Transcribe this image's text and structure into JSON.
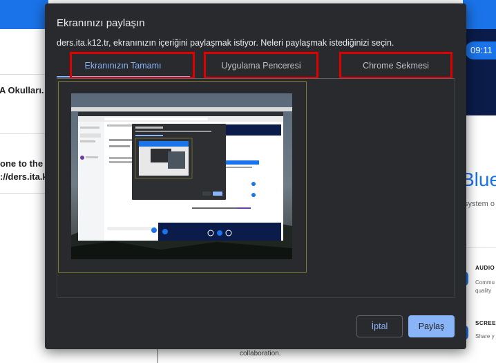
{
  "background": {
    "time": "09:11",
    "left_text_1": "A Okulları.",
    "left_text_2": "one to the",
    "left_text_3": "://ders.ita.k",
    "bottom_text": "collaboration.",
    "right_title": "Blue",
    "right_subtitle": "system o",
    "feature_1_label": "AUDIO",
    "feature_1_text_a": "Commu",
    "feature_1_text_b": "quality",
    "feature_2_label": "SCREE",
    "feature_2_text": "Share y"
  },
  "dialog": {
    "title": "Ekranınızı paylaşın",
    "description": "ders.ita.k12.tr, ekranınızın içeriğini paylaşmak istiyor. Neleri paylaşmak istediğinizi seçin.",
    "tabs": [
      {
        "label": "Ekranınızın Tamamı",
        "active": true
      },
      {
        "label": "Uygulama Penceresi",
        "active": false
      },
      {
        "label": "Chrome Sekmesi",
        "active": false
      }
    ],
    "cancel_label": "İptal",
    "share_label": "Paylaş"
  },
  "colors": {
    "accent": "#8ab4f8",
    "highlight": "#e00000",
    "dialog_bg": "#292a2d",
    "page_blue": "#1a73e8"
  }
}
